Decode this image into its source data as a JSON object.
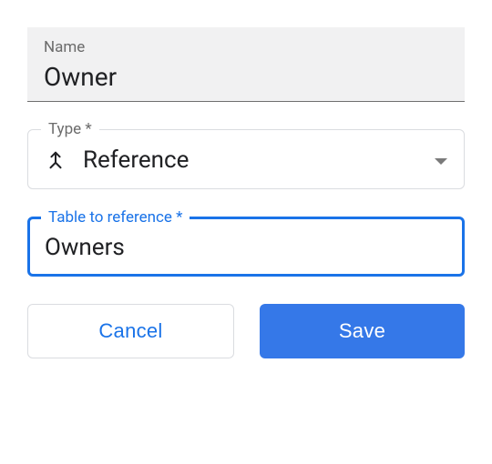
{
  "nameField": {
    "label": "Name",
    "value": "Owner"
  },
  "typeField": {
    "label": "Type *",
    "value": "Reference",
    "icon": "merge-icon"
  },
  "tableRefField": {
    "label": "Table to reference *",
    "value": "Owners"
  },
  "buttons": {
    "cancel": "Cancel",
    "save": "Save"
  }
}
